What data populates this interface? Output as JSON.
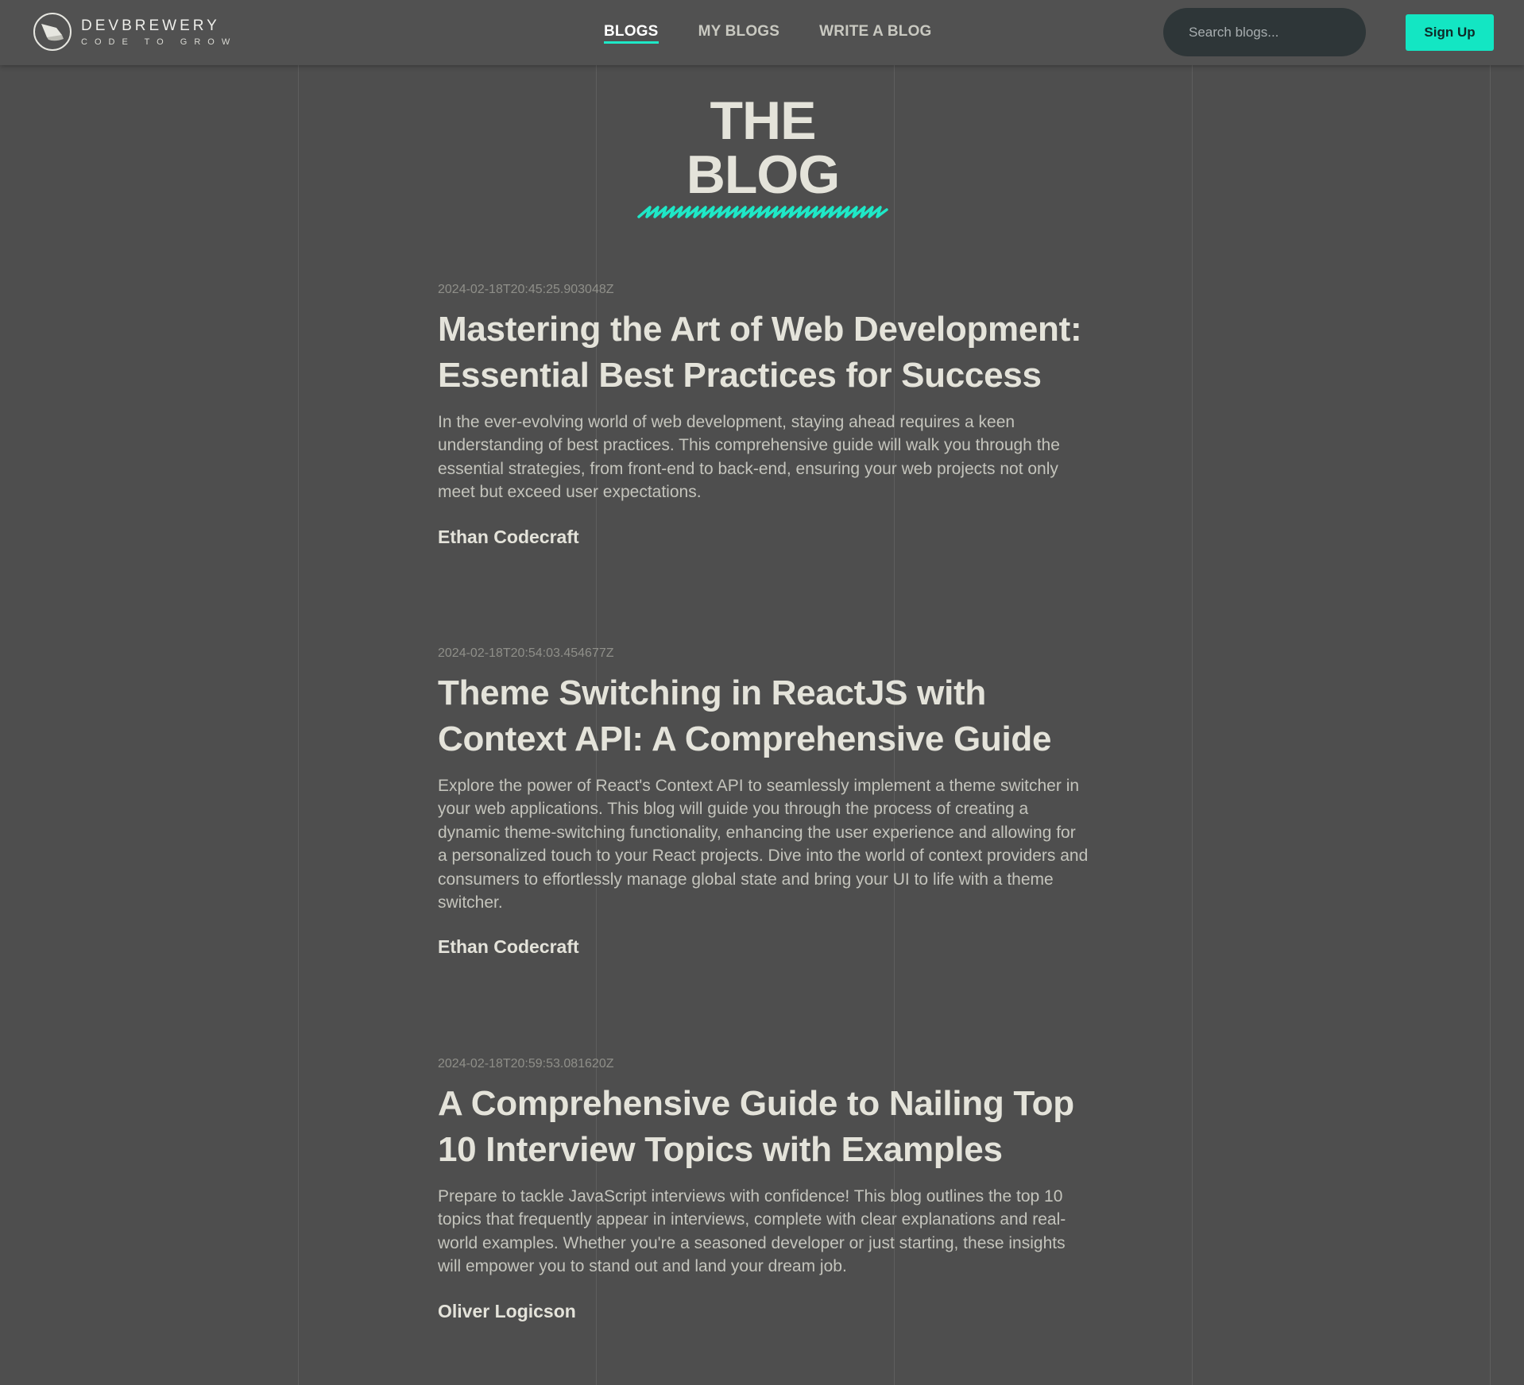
{
  "brand": {
    "name": "DEVBREWERY",
    "tagline": "CODE TO GROW"
  },
  "nav": {
    "items": [
      {
        "label": "BLOGS",
        "active": true
      },
      {
        "label": "MY BLOGS",
        "active": false
      },
      {
        "label": "WRITE A BLOG",
        "active": false
      }
    ]
  },
  "search": {
    "placeholder": "Search blogs..."
  },
  "auth": {
    "signup_label": "Sign Up"
  },
  "page": {
    "title": "THE BLOG"
  },
  "posts": [
    {
      "date": "2024-02-18T20:45:25.903048Z",
      "title": "Mastering the Art of Web Development: Essential Best Practices for Success",
      "excerpt": "In the ever-evolving world of web development, staying ahead requires a keen understanding of best practices. This comprehensive guide will walk you through the essential strategies, from front-end to back-end, ensuring your web projects not only meet but exceed user expectations.",
      "author": "Ethan Codecraft"
    },
    {
      "date": "2024-02-18T20:54:03.454677Z",
      "title": "Theme Switching in ReactJS with Context API: A Comprehensive Guide",
      "excerpt": "Explore the power of React's Context API to seamlessly implement a theme switcher in your web applications. This blog will guide you through the process of creating a dynamic theme-switching functionality, enhancing the user experience and allowing for a personalized touch to your React projects. Dive into the world of context providers and consumers to effortlessly manage global state and bring your UI to life with a theme switcher.",
      "author": "Ethan Codecraft"
    },
    {
      "date": "2024-02-18T20:59:53.081620Z",
      "title": "A Comprehensive Guide to Nailing Top 10 Interview Topics with Examples",
      "excerpt": "Prepare to tackle JavaScript interviews with confidence! This blog outlines the top 10 topics that frequently appear in interviews, complete with clear explanations and real-world examples. Whether you're a seasoned developer or just starting, these insights will empower you to stand out and land your dream job.",
      "author": "Oliver Logicson"
    }
  ],
  "colors": {
    "background": "#4e4e4e",
    "accent": "#13e6c3",
    "text_primary": "#e4e3da",
    "text_secondary": "#c4c4bc",
    "search_bg": "#2e3638"
  },
  "icons": {
    "logo": "brewery-logo-icon",
    "search": "search-icon"
  }
}
